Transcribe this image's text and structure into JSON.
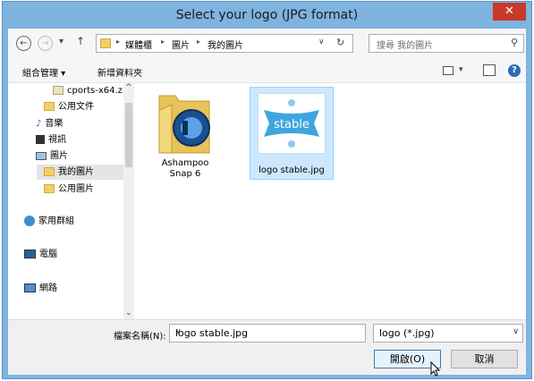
{
  "window": {
    "title": "Select your logo (JPG format)",
    "close_glyph": "✕"
  },
  "address": {
    "back_glyph": "←",
    "forward_glyph": "→",
    "recent_glyph": "▾",
    "up_glyph": "↑",
    "crumbs": [
      "媒體櫃",
      "圖片",
      "我的圖片"
    ],
    "sep": "▸",
    "dropdown_glyph": "∨",
    "refresh_glyph": "↻"
  },
  "search": {
    "placeholder": "搜尋 我的圖片",
    "icon_glyph": "⚲"
  },
  "toolbar": {
    "organize": "組合管理 ▾",
    "new_folder": "新增資料夾",
    "help_glyph": "?"
  },
  "nav": {
    "items": [
      {
        "label": "cports-x64.z"
      },
      {
        "label": "公用文件"
      },
      {
        "label": "音樂"
      },
      {
        "label": "視訊"
      },
      {
        "label": "圖片"
      },
      {
        "label": "我的圖片"
      },
      {
        "label": "公用圖片"
      },
      {
        "label": "家用群組"
      },
      {
        "label": "電腦"
      },
      {
        "label": "網路"
      }
    ],
    "scroll_up": "^",
    "scroll_down": "⌄"
  },
  "files": [
    {
      "name": "Ashampoo Snap 6"
    },
    {
      "name": "logo stable.jpg",
      "thumb_text": "stable"
    }
  ],
  "bottom": {
    "filename_label": "檔案名稱(N):",
    "filename_value": "logo stable.jpg",
    "filter_value": "logo (*.jpg)",
    "open_label": "開啟(O)",
    "cancel_label": "取消"
  },
  "colors": {
    "accent": "#7fb3e0",
    "close": "#c7392b",
    "selection": "#cce8ff"
  }
}
